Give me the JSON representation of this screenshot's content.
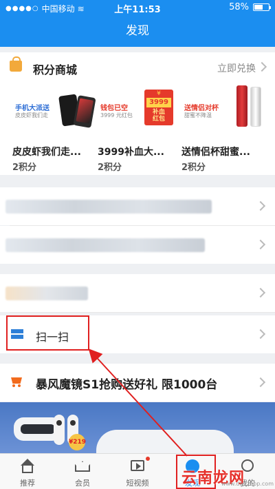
{
  "status_bar": {
    "carrier": "中国移动",
    "time": "上午11:53",
    "battery": "58%"
  },
  "nav": {
    "title": "发现"
  },
  "shop": {
    "title": "积分商城",
    "exchange_label": "立即兑换",
    "products": [
      {
        "promo_main": "手机大派送",
        "promo_sub": "皮皮虾我们走",
        "name": "皮皮虾我们走...",
        "points": "2积分"
      },
      {
        "promo_main": "钱包已空",
        "promo_sub": "3999 元红包",
        "badge_yen": "¥",
        "badge_amount": "3999",
        "badge_text1": "补血",
        "badge_text2": "红包",
        "name": "3999补血大...",
        "points": "2积分"
      },
      {
        "promo_main": "送情侣对杯",
        "promo_sub": "甜蜜不降温",
        "name": "送情侣杯甜蜜...",
        "points": "2积分"
      }
    ]
  },
  "scan": {
    "label": "扫一扫"
  },
  "storm": {
    "label": "暴风魔镜S1抢购送好礼 限1000台"
  },
  "banner": {
    "price": "219"
  },
  "tabbar": {
    "tabs": [
      {
        "label": "推荐"
      },
      {
        "label": "会员"
      },
      {
        "label": "短视频"
      },
      {
        "label": "发现"
      },
      {
        "label": "我的"
      }
    ]
  },
  "watermark": {
    "text": "云南龙网",
    "url": "www.dwzzapp.com"
  },
  "colors": {
    "primary": "#1b8ef0",
    "highlight": "#e01f1f",
    "shop_icon": "#f2a93b",
    "storm_icon": "#f26b1d"
  }
}
